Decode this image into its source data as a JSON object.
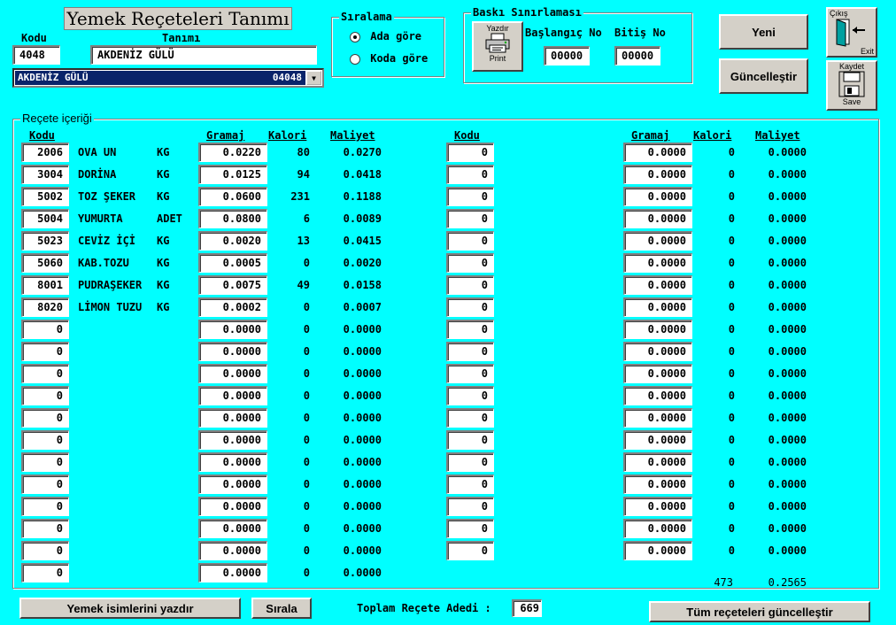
{
  "title": "Yemek Reçeteleri Tanımı",
  "header": {
    "kodu_label": "Kodu",
    "tanimi_label": "Tanımı",
    "kodu_value": "4048",
    "tanimi_value": "AKDENİZ GÜLÜ",
    "combo_name": "AKDENİZ GÜLÜ",
    "combo_code": "04048"
  },
  "siralama": {
    "title": "Sıralama",
    "options": [
      "Ada göre",
      "Koda göre"
    ],
    "selected": 0
  },
  "baski": {
    "title": "Baskı Sınırlaması",
    "print_top": "Yazdır",
    "print_bottom": "Print",
    "start_label": "Başlangıç No",
    "end_label": "Bitiş No",
    "start_value": "00000",
    "end_value": "00000"
  },
  "buttons": {
    "yeni": "Yeni",
    "guncelle": "Güncelleştir",
    "exit_top": "Çıkış",
    "exit_bottom": "Exit",
    "save_top": "Kaydet",
    "save_bottom": "Save",
    "print_names": "Yemek isimlerini yazdır",
    "sirala": "Sırala",
    "update_all": "Tüm reçeteleri güncelleştir"
  },
  "recipe": {
    "group_title": "Reçete içeriği",
    "headers": {
      "kodu": "Kodu",
      "gramaj": "Gramaj",
      "kalori": "Kalori",
      "maliyet": "Maliyet"
    },
    "left_rows": [
      {
        "kodu": "2006",
        "name": "OVA UN",
        "unit": "KG",
        "gramaj": "0.0220",
        "kalori": "80",
        "maliyet": "0.0270"
      },
      {
        "kodu": "3004",
        "name": "DORİNA",
        "unit": "KG",
        "gramaj": "0.0125",
        "kalori": "94",
        "maliyet": "0.0418"
      },
      {
        "kodu": "5002",
        "name": "TOZ ŞEKER",
        "unit": "KG",
        "gramaj": "0.0600",
        "kalori": "231",
        "maliyet": "0.1188"
      },
      {
        "kodu": "5004",
        "name": "YUMURTA",
        "unit": "ADET",
        "gramaj": "0.0800",
        "kalori": "6",
        "maliyet": "0.0089"
      },
      {
        "kodu": "5023",
        "name": "CEVİZ İÇİ",
        "unit": "KG",
        "gramaj": "0.0020",
        "kalori": "13",
        "maliyet": "0.0415"
      },
      {
        "kodu": "5060",
        "name": "KAB.TOZU",
        "unit": "KG",
        "gramaj": "0.0005",
        "kalori": "0",
        "maliyet": "0.0020"
      },
      {
        "kodu": "8001",
        "name": "PUDRAŞEKER",
        "unit": "KG",
        "gramaj": "0.0075",
        "kalori": "49",
        "maliyet": "0.0158"
      },
      {
        "kodu": "8020",
        "name": "LİMON TUZU",
        "unit": "KG",
        "gramaj": "0.0002",
        "kalori": "0",
        "maliyet": "0.0007"
      },
      {
        "kodu": "0",
        "name": "",
        "unit": "",
        "gramaj": "0.0000",
        "kalori": "0",
        "maliyet": "0.0000"
      },
      {
        "kodu": "0",
        "name": "",
        "unit": "",
        "gramaj": "0.0000",
        "kalori": "0",
        "maliyet": "0.0000"
      },
      {
        "kodu": "0",
        "name": "",
        "unit": "",
        "gramaj": "0.0000",
        "kalori": "0",
        "maliyet": "0.0000"
      },
      {
        "kodu": "0",
        "name": "",
        "unit": "",
        "gramaj": "0.0000",
        "kalori": "0",
        "maliyet": "0.0000"
      },
      {
        "kodu": "0",
        "name": "",
        "unit": "",
        "gramaj": "0.0000",
        "kalori": "0",
        "maliyet": "0.0000"
      },
      {
        "kodu": "0",
        "name": "",
        "unit": "",
        "gramaj": "0.0000",
        "kalori": "0",
        "maliyet": "0.0000"
      },
      {
        "kodu": "0",
        "name": "",
        "unit": "",
        "gramaj": "0.0000",
        "kalori": "0",
        "maliyet": "0.0000"
      },
      {
        "kodu": "0",
        "name": "",
        "unit": "",
        "gramaj": "0.0000",
        "kalori": "0",
        "maliyet": "0.0000"
      },
      {
        "kodu": "0",
        "name": "",
        "unit": "",
        "gramaj": "0.0000",
        "kalori": "0",
        "maliyet": "0.0000"
      },
      {
        "kodu": "0",
        "name": "",
        "unit": "",
        "gramaj": "0.0000",
        "kalori": "0",
        "maliyet": "0.0000"
      },
      {
        "kodu": "0",
        "name": "",
        "unit": "",
        "gramaj": "0.0000",
        "kalori": "0",
        "maliyet": "0.0000"
      },
      {
        "kodu": "0",
        "name": "",
        "unit": "",
        "gramaj": "0.0000",
        "kalori": "0",
        "maliyet": "0.0000"
      }
    ],
    "right_rows": [
      {
        "kodu": "0",
        "gramaj": "0.0000",
        "kalori": "0",
        "maliyet": "0.0000"
      },
      {
        "kodu": "0",
        "gramaj": "0.0000",
        "kalori": "0",
        "maliyet": "0.0000"
      },
      {
        "kodu": "0",
        "gramaj": "0.0000",
        "kalori": "0",
        "maliyet": "0.0000"
      },
      {
        "kodu": "0",
        "gramaj": "0.0000",
        "kalori": "0",
        "maliyet": "0.0000"
      },
      {
        "kodu": "0",
        "gramaj": "0.0000",
        "kalori": "0",
        "maliyet": "0.0000"
      },
      {
        "kodu": "0",
        "gramaj": "0.0000",
        "kalori": "0",
        "maliyet": "0.0000"
      },
      {
        "kodu": "0",
        "gramaj": "0.0000",
        "kalori": "0",
        "maliyet": "0.0000"
      },
      {
        "kodu": "0",
        "gramaj": "0.0000",
        "kalori": "0",
        "maliyet": "0.0000"
      },
      {
        "kodu": "0",
        "gramaj": "0.0000",
        "kalori": "0",
        "maliyet": "0.0000"
      },
      {
        "kodu": "0",
        "gramaj": "0.0000",
        "kalori": "0",
        "maliyet": "0.0000"
      },
      {
        "kodu": "0",
        "gramaj": "0.0000",
        "kalori": "0",
        "maliyet": "0.0000"
      },
      {
        "kodu": "0",
        "gramaj": "0.0000",
        "kalori": "0",
        "maliyet": "0.0000"
      },
      {
        "kodu": "0",
        "gramaj": "0.0000",
        "kalori": "0",
        "maliyet": "0.0000"
      },
      {
        "kodu": "0",
        "gramaj": "0.0000",
        "kalori": "0",
        "maliyet": "0.0000"
      },
      {
        "kodu": "0",
        "gramaj": "0.0000",
        "kalori": "0",
        "maliyet": "0.0000"
      },
      {
        "kodu": "0",
        "gramaj": "0.0000",
        "kalori": "0",
        "maliyet": "0.0000"
      },
      {
        "kodu": "0",
        "gramaj": "0.0000",
        "kalori": "0",
        "maliyet": "0.0000"
      },
      {
        "kodu": "0",
        "gramaj": "0.0000",
        "kalori": "0",
        "maliyet": "0.0000"
      },
      {
        "kodu": "0",
        "gramaj": "0.0000",
        "kalori": "0",
        "maliyet": "0.0000"
      }
    ],
    "total_kalori": "473",
    "total_maliyet": "0.2565"
  },
  "footer": {
    "count_label": "Toplam Reçete Adedi :",
    "count_value": "669"
  }
}
